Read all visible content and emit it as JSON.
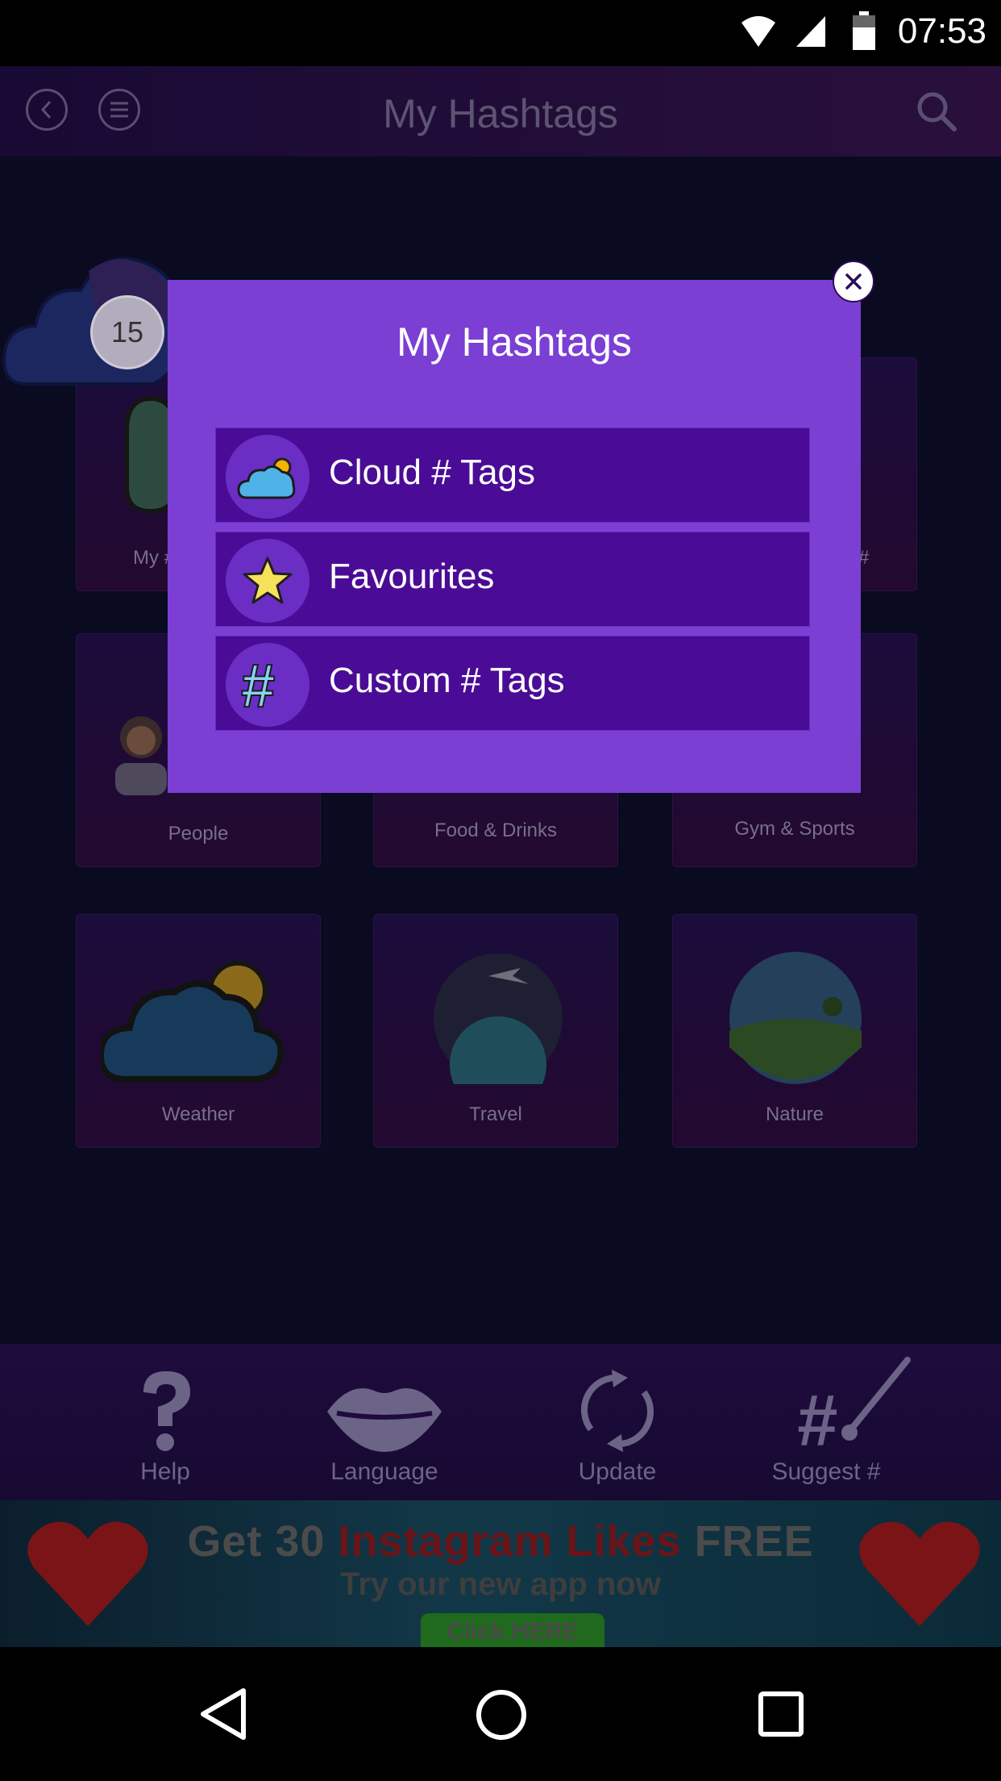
{
  "status_bar": {
    "time": "07:53"
  },
  "header": {
    "title": "My Hashtags"
  },
  "grid": {
    "tiles": [
      {
        "label": "My #"
      },
      {
        "label": ""
      },
      {
        "label": "#"
      },
      {
        "label": "People"
      },
      {
        "label": "Food & Drinks"
      },
      {
        "label": "Gym & Sports"
      },
      {
        "label": "Weather"
      },
      {
        "label": "Travel"
      },
      {
        "label": "Nature"
      }
    ]
  },
  "cloud_badge": {
    "count": "15"
  },
  "modal": {
    "title": "My Hashtags",
    "items": [
      {
        "label": "Cloud # Tags",
        "icon": "cloud-sun-icon"
      },
      {
        "label": "Favourites",
        "icon": "star-icon"
      },
      {
        "label": "Custom # Tags",
        "icon": "hashtag-icon"
      }
    ]
  },
  "bottom_nav": {
    "items": [
      {
        "label": "Help",
        "icon": "question-icon"
      },
      {
        "label": "Language",
        "icon": "lips-icon"
      },
      {
        "label": "Update",
        "icon": "refresh-icon"
      },
      {
        "label": "Suggest #",
        "icon": "hashtag-brush-icon"
      }
    ]
  },
  "banner": {
    "line1_a": "Get 30 ",
    "line1_b": "Instagram Likes",
    "line1_c": " FREE",
    "line2": "Try our new app now",
    "button": "Click HERE"
  },
  "colors": {
    "modal_bg": "#7b3fd4",
    "menu_item_bg": "#4a0c96",
    "banner_red": "#7a1417"
  }
}
